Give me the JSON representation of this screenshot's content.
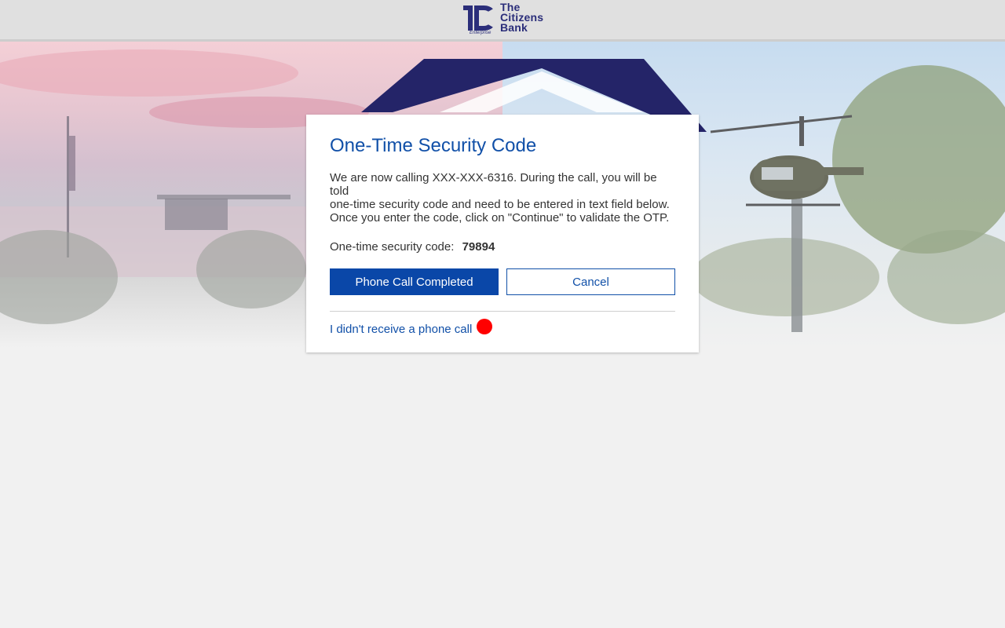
{
  "header": {
    "logo_line1": "The",
    "logo_line2": "Citizens",
    "logo_line3": "Bank",
    "logo_sub": "Enterprise"
  },
  "dialog": {
    "title": "One-Time Security Code",
    "message": "We are now calling XXX-XXX-6316. During the call, you will be told\n one-time security code and need to be entered in text field below.\nOnce you enter the code, click on \"Continue\" to validate the OTP.",
    "code_label": "One-time security code:",
    "code_value": "79894",
    "primary_button": "Phone Call Completed",
    "cancel_button": "Cancel",
    "resend_link": "I didn't receive a phone call"
  },
  "colors": {
    "accent": "#0a47a8",
    "title": "#1150a8",
    "indicator": "#ff0000"
  }
}
